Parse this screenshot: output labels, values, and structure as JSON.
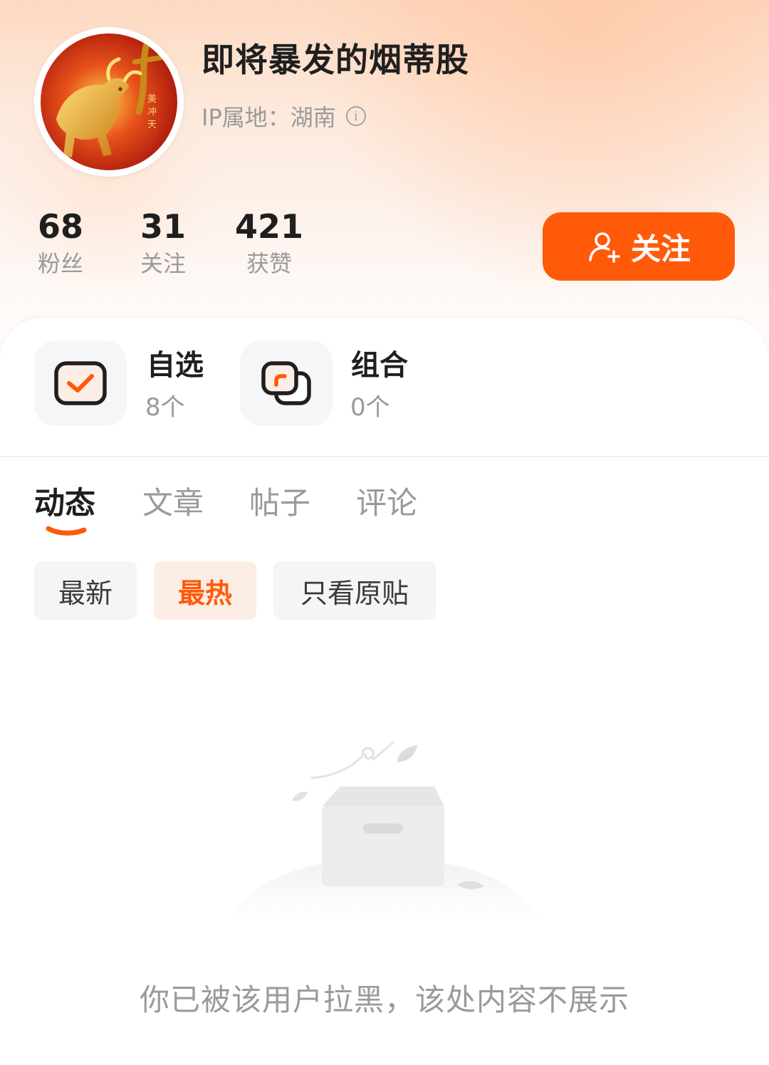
{
  "profile": {
    "username": "即将暴发的烟蒂股",
    "ip_label": "IP属地：湖南",
    "avatar_icon": "golden-bull-avatar"
  },
  "stats": [
    {
      "value": "68",
      "label": "粉丝"
    },
    {
      "value": "31",
      "label": "关注"
    },
    {
      "value": "421",
      "label": "获赞"
    }
  ],
  "follow_button": {
    "label": "关注",
    "icon": "add-user-icon",
    "color": "#ff5a0a"
  },
  "cards": [
    {
      "title": "自选",
      "count": "8个",
      "icon": "watchlist-check-icon"
    },
    {
      "title": "组合",
      "count": "0个",
      "icon": "portfolio-icon"
    }
  ],
  "tabs": [
    {
      "label": "动态",
      "active": true
    },
    {
      "label": "文章",
      "active": false
    },
    {
      "label": "帖子",
      "active": false
    },
    {
      "label": "评论",
      "active": false
    }
  ],
  "filters": [
    {
      "label": "最新",
      "active": false
    },
    {
      "label": "最热",
      "active": true
    },
    {
      "label": "只看原贴",
      "active": false
    }
  ],
  "empty_state": {
    "message": "你已被该用户拉黑，该处内容不展示",
    "icon": "empty-box-illustration"
  },
  "colors": {
    "accent": "#ff5a0a",
    "accent_light": "#fdeee5"
  }
}
